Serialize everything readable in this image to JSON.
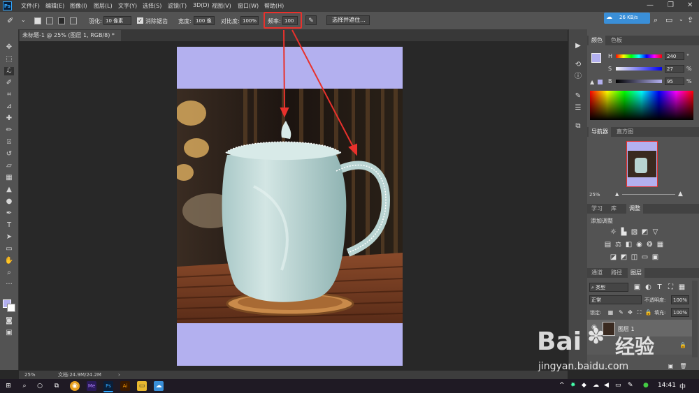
{
  "menubar": {
    "app_icon": "Ps",
    "items": [
      "文件(F)",
      "编辑(E)",
      "图像(I)",
      "图层(L)",
      "文字(Y)",
      "选择(S)",
      "滤镜(T)",
      "3D(D)",
      "视图(V)",
      "窗口(W)",
      "帮助(H)"
    ],
    "speed_badge": "26 KB/s"
  },
  "options_bar": {
    "feather_label": "羽化:",
    "feather_value": "10 像素",
    "antialias_label": "消除锯齿",
    "width_label": "宽度:",
    "width_value": "100 像",
    "contrast_label": "对比度:",
    "contrast_value": "100%",
    "frequency_label": "频率:",
    "frequency_value": "100",
    "select_mask_button": "选择并遮住..."
  },
  "document": {
    "tab_title": "未标题-1 @ 25% (图层 1, RGB/8) *",
    "zoom": "25%",
    "doc_info": "文档:24.9M/24.2M"
  },
  "color_panel": {
    "tabs": [
      "颜色",
      "色板"
    ],
    "h_label": "H",
    "h_value": "240",
    "s_label": "S",
    "s_value": "27",
    "b_label": "B",
    "b_value": "95",
    "unit": "%",
    "degree": "°"
  },
  "navigator_panel": {
    "tabs": [
      "导航器",
      "直方图"
    ],
    "zoom": "25%"
  },
  "adjust_panel": {
    "tabs": [
      "学习",
      "库",
      "调整"
    ],
    "title": "添加调整"
  },
  "layers_panel": {
    "tabs": [
      "通道",
      "路径",
      "图层"
    ],
    "filter_label": "类型",
    "blend_mode": "正常",
    "opacity_label": "不透明度:",
    "opacity_value": "100%",
    "lock_label": "锁定:",
    "fill_label": "填充:",
    "fill_value": "100%",
    "layer_name": "图层 1"
  },
  "taskbar": {
    "time": "14:41",
    "ime": "中"
  },
  "watermark": {
    "brand": "Bai",
    "brand_cn": "经验",
    "url": "jingyan.baidu.com"
  },
  "colors": {
    "accent_red": "#e8312c",
    "foreground_color": "#b3b0ef",
    "ps_blue": "#31a8ff"
  }
}
